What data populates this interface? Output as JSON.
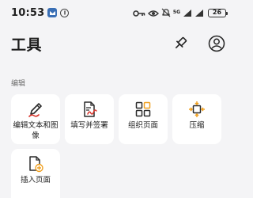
{
  "status_bar": {
    "time": "10:53",
    "network_label": "5G",
    "battery_level": "26"
  },
  "header": {
    "title": "工具"
  },
  "sections": [
    {
      "label": "编辑",
      "tools": [
        {
          "label": "编辑文本和图像",
          "icon": "edit-pen-icon"
        },
        {
          "label": "填写并签署",
          "icon": "fill-sign-icon"
        },
        {
          "label": "组织页面",
          "icon": "organize-grid-icon"
        },
        {
          "label": "压缩",
          "icon": "compress-icon"
        },
        {
          "label": "插入页面",
          "icon": "insert-page-icon"
        }
      ]
    }
  ],
  "colors": {
    "background": "#f4f4f6",
    "card": "#ffffff",
    "accent_red": "#d9342b",
    "accent_orange": "#f0a020",
    "icon_dark": "#2b2b2b"
  }
}
